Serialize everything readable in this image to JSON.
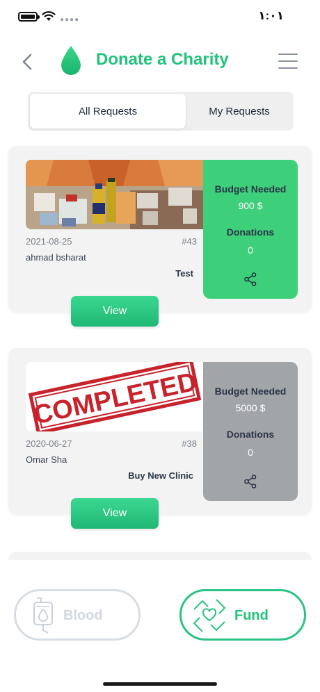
{
  "status_bar": {
    "time": "١:٠١"
  },
  "header": {
    "title": "Donate a Charity"
  },
  "tabs": {
    "all_requests": "All Requests",
    "my_requests": "My Requests"
  },
  "requests": [
    {
      "date": "2021-08-25",
      "number": "#43",
      "requester": "ahmad bsharat",
      "title": "Test",
      "budget_label": "Budget Needed",
      "budget_value": "900 $",
      "donations_label": "Donations",
      "donations_value": "0",
      "panel_color": "#3ecf7a",
      "image": "food-supplies-photo",
      "view_label": "View"
    },
    {
      "date": "2020-06-27",
      "number": "#38",
      "requester": "Omar Sha",
      "title": "Buy New Clinic",
      "budget_label": "Budget Needed",
      "budget_value": "5000 $",
      "donations_label": "Donations",
      "donations_value": "0",
      "panel_color": "#a2a5a8",
      "image": "completed-stamp",
      "stamp_text": "COMPLETED",
      "view_label": "View"
    }
  ],
  "bottom_nav": {
    "blood_label": "Blood",
    "fund_label": "Fund"
  },
  "colors": {
    "accent": "#22c27a",
    "active_panel": "#3ecf7a",
    "completed_panel": "#a2a5a8"
  }
}
